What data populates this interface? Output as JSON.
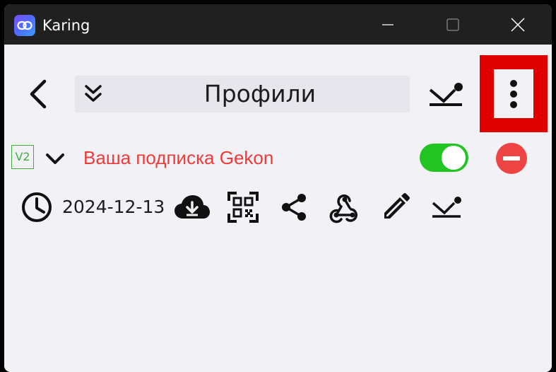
{
  "window": {
    "app_title": "Karing",
    "app_icon": "link-icon",
    "controls": [
      "minimize-icon",
      "maximize-icon",
      "close-icon"
    ]
  },
  "header": {
    "title": "Профили",
    "back_icon": "chevron-left-icon",
    "collapse_icon": "double-chevron-down-icon",
    "import_icon": "import-icon",
    "more_icon": "more-vertical-icon",
    "highlight_color": "#e00000"
  },
  "profile": {
    "version": "V2",
    "name": "Ваша подписка Gekon",
    "name_color": "#f03a3a",
    "enabled": true,
    "toggle_color": "#22c422",
    "delete_color": "#ef4444",
    "updated_date": "2024-12-13",
    "actions": [
      "clock-icon",
      "cloud-download-icon",
      "qr-code-icon",
      "share-icon",
      "webhook-icon",
      "edit-icon",
      "import-icon"
    ]
  }
}
